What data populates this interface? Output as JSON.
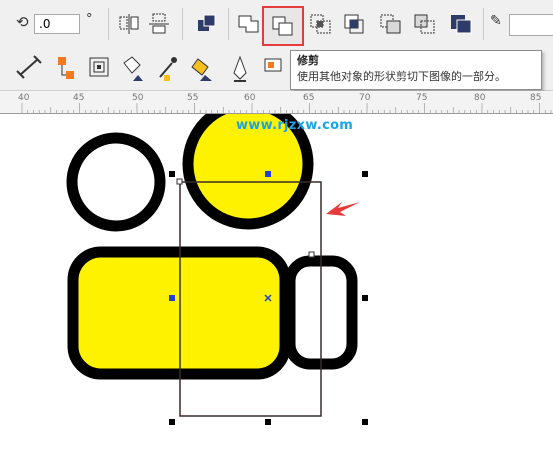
{
  "toolbar": {
    "rotation_value": ".0",
    "degree_symbol": "°",
    "buttons_row1": [
      {
        "name": "rotation-icon"
      },
      {
        "name": "mirror-horizontal-icon"
      },
      {
        "name": "mirror-vertical-icon"
      },
      {
        "name": "combine-icon"
      },
      {
        "name": "weld-icon"
      },
      {
        "name": "trim-icon",
        "active": true
      },
      {
        "name": "intersect-icon"
      },
      {
        "name": "simplify-icon"
      },
      {
        "name": "front-minus-back-icon"
      },
      {
        "name": "back-minus-front-icon"
      },
      {
        "name": "create-boundary-icon"
      },
      {
        "name": "pen-outline-icon"
      }
    ],
    "buttons_row2": [
      "dimension-tool-icon",
      "connector-tool-icon",
      "contour-tool-icon",
      "fill-bucket-icon",
      "eyedropper-icon",
      "interactive-fill-icon",
      "pen-nib-icon",
      "text-image-icon"
    ],
    "highlight_color": "#e53b3b"
  },
  "tooltip": {
    "title": "修剪",
    "description": "使用其他对象的形状剪切下图像的一部分。"
  },
  "ruler": {
    "labels": [
      "40",
      "45",
      "50",
      "55",
      "60",
      "65",
      "70",
      "75",
      "80",
      "85"
    ]
  },
  "canvas": {
    "watermark": "www.rjzxw.com",
    "fill_color": "#fff200",
    "outline_color": "#000000",
    "arrow_color": "#e53b3b",
    "handle_color": "#000000",
    "center_marker_color": "#1f3fd6"
  }
}
